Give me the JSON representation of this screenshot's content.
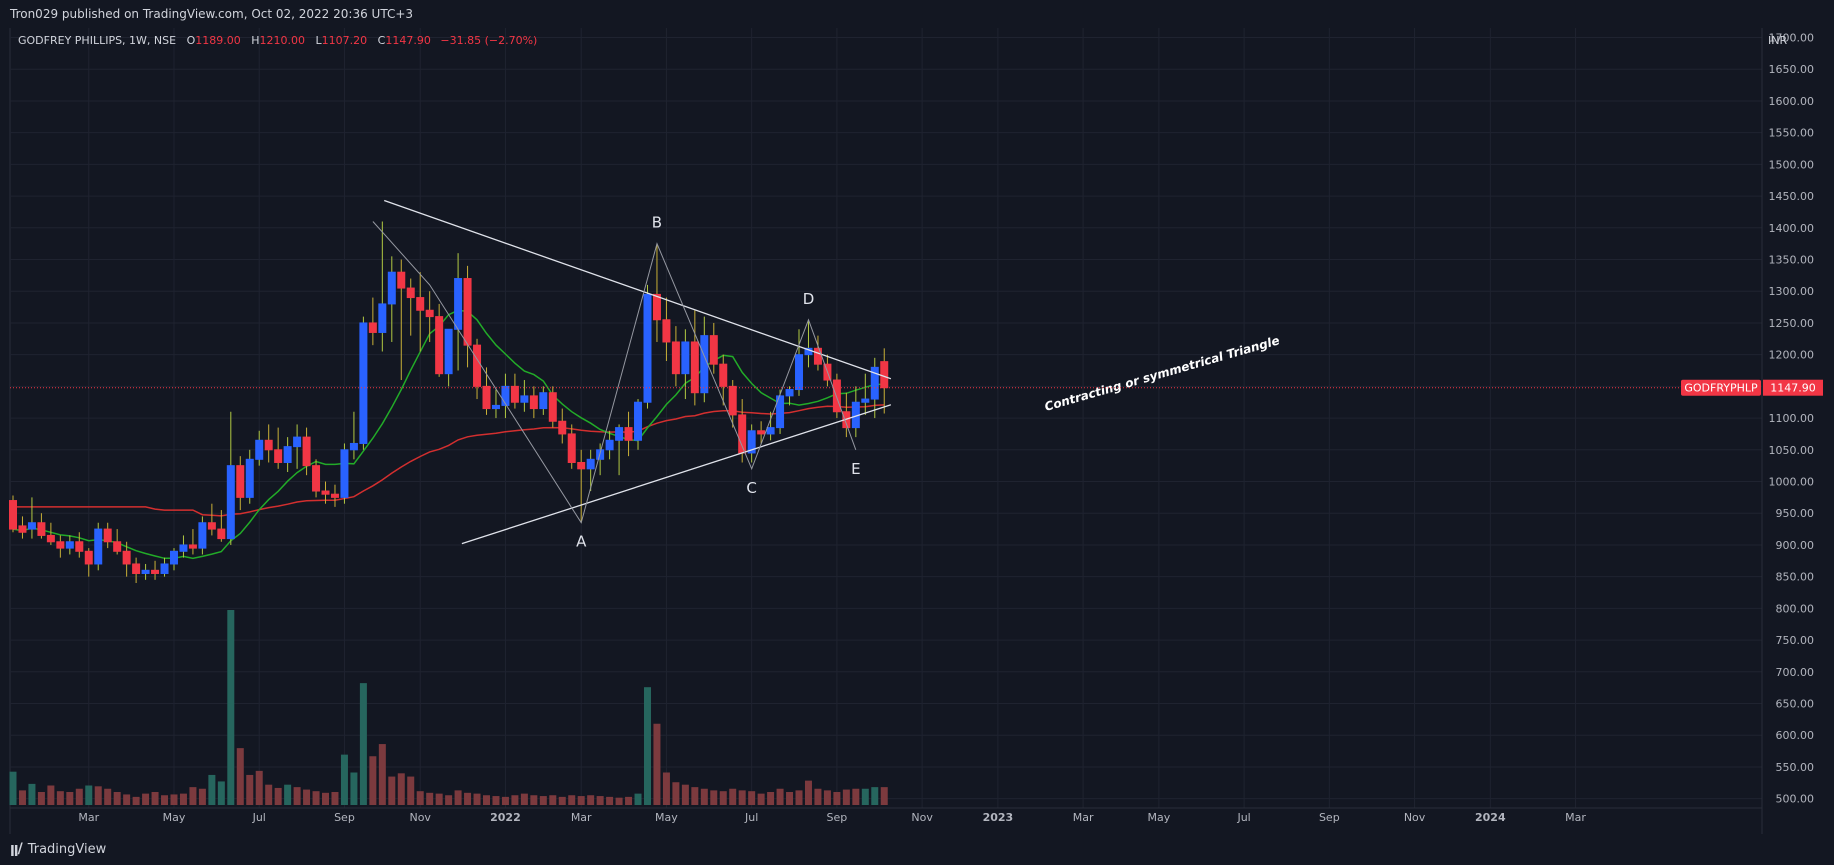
{
  "header": {
    "published_by": "Tron029 published on TradingView.com, Oct 02, 2022 20:36 UTC+3"
  },
  "legend": {
    "symbol_line": "GODFREY PHILLIPS, 1W, NSE",
    "open_label": "O",
    "open_value": "1189.00",
    "high_label": "H",
    "high_value": "1210.00",
    "low_label": "L",
    "low_value": "1107.20",
    "close_label": "C",
    "close_value": "1147.90",
    "change": "−31.85 (−2.70%)"
  },
  "price_axis": {
    "currency": "INR",
    "tag_symbol": "GODFRYPHLP",
    "tag_price": "1147.90"
  },
  "footer": {
    "brand_icon": "tradingview-logo-icon",
    "brand_name": "TradingView"
  },
  "colors": {
    "background": "#131722",
    "grid": "#1f2330",
    "up": "#2962ff",
    "down": "#f23645",
    "wick_up": "#b2c943",
    "ema_fast": "#22ab28",
    "ema_slow": "#d32f2f",
    "vol_up": "#26665e",
    "vol_down": "#7c3a3e",
    "trendline": "#e0e3eb"
  },
  "chart_data": {
    "type": "candlestick",
    "title": "GODFREY PHILLIPS, 1W, NSE",
    "ylabel": "INR",
    "ylim": [
      490,
      1715
    ],
    "y_ticks": [
      "500.00",
      "550.00",
      "600.00",
      "650.00",
      "700.00",
      "750.00",
      "800.00",
      "850.00",
      "900.00",
      "950.00",
      "1000.00",
      "1050.00",
      "1100.00",
      "1150.00",
      "1200.00",
      "1250.00",
      "1300.00",
      "1350.00",
      "1400.00",
      "1450.00",
      "1500.00",
      "1550.00",
      "1600.00",
      "1650.00",
      "1700.00"
    ],
    "x_ticks": [
      {
        "label": "Mar",
        "week": 8
      },
      {
        "label": "May",
        "week": 17
      },
      {
        "label": "Jul",
        "week": 26
      },
      {
        "label": "Sep",
        "week": 35
      },
      {
        "label": "Nov",
        "week": 43
      },
      {
        "label": "2022",
        "week": 52
      },
      {
        "label": "Mar",
        "week": 60
      },
      {
        "label": "May",
        "week": 69
      },
      {
        "label": "Jul",
        "week": 78
      },
      {
        "label": "Sep",
        "week": 87
      },
      {
        "label": "Nov",
        "week": 96
      },
      {
        "label": "2023",
        "week": 104
      },
      {
        "label": "Mar",
        "week": 113
      },
      {
        "label": "May",
        "week": 121
      },
      {
        "label": "Jul",
        "week": 130
      },
      {
        "label": "Sep",
        "week": 139
      },
      {
        "label": "Nov",
        "week": 148
      },
      {
        "label": "2024",
        "week": 156
      },
      {
        "label": "Mar",
        "week": 165
      }
    ],
    "candles": [
      [
        970,
        978,
        920,
        925
      ],
      [
        930,
        945,
        910,
        920
      ],
      [
        925,
        975,
        910,
        935
      ],
      [
        935,
        950,
        910,
        915
      ],
      [
        915,
        935,
        900,
        905
      ],
      [
        905,
        915,
        880,
        895
      ],
      [
        895,
        915,
        885,
        905
      ],
      [
        905,
        920,
        880,
        890
      ],
      [
        890,
        895,
        850,
        870
      ],
      [
        870,
        935,
        860,
        925
      ],
      [
        925,
        935,
        895,
        905
      ],
      [
        905,
        925,
        885,
        890
      ],
      [
        890,
        905,
        850,
        870
      ],
      [
        870,
        880,
        840,
        855
      ],
      [
        855,
        870,
        845,
        860
      ],
      [
        860,
        875,
        845,
        855
      ],
      [
        855,
        880,
        850,
        870
      ],
      [
        870,
        895,
        860,
        890
      ],
      [
        890,
        915,
        880,
        900
      ],
      [
        900,
        925,
        885,
        895
      ],
      [
        895,
        945,
        885,
        935
      ],
      [
        935,
        965,
        915,
        925
      ],
      [
        925,
        955,
        905,
        910
      ],
      [
        910,
        1110,
        900,
        1025
      ],
      [
        1025,
        1040,
        955,
        975
      ],
      [
        975,
        1050,
        965,
        1035
      ],
      [
        1035,
        1080,
        1025,
        1065
      ],
      [
        1065,
        1090,
        1030,
        1050
      ],
      [
        1050,
        1085,
        1020,
        1030
      ],
      [
        1030,
        1070,
        1015,
        1055
      ],
      [
        1055,
        1090,
        1020,
        1070
      ],
      [
        1070,
        1085,
        1010,
        1025
      ],
      [
        1025,
        1035,
        975,
        985
      ],
      [
        985,
        1000,
        965,
        980
      ],
      [
        980,
        995,
        960,
        975
      ],
      [
        975,
        1060,
        965,
        1050
      ],
      [
        1050,
        1110,
        1035,
        1060
      ],
      [
        1060,
        1260,
        1050,
        1250
      ],
      [
        1250,
        1290,
        1215,
        1235
      ],
      [
        1235,
        1410,
        1205,
        1280
      ],
      [
        1280,
        1355,
        1220,
        1330
      ],
      [
        1330,
        1350,
        1160,
        1305
      ],
      [
        1305,
        1320,
        1230,
        1290
      ],
      [
        1290,
        1330,
        1205,
        1270
      ],
      [
        1270,
        1300,
        1220,
        1260
      ],
      [
        1260,
        1280,
        1165,
        1170
      ],
      [
        1170,
        1240,
        1150,
        1240
      ],
      [
        1240,
        1360,
        1175,
        1320
      ],
      [
        1320,
        1340,
        1180,
        1215
      ],
      [
        1215,
        1225,
        1130,
        1150
      ],
      [
        1150,
        1180,
        1105,
        1115
      ],
      [
        1115,
        1145,
        1100,
        1120
      ],
      [
        1120,
        1170,
        1100,
        1150
      ],
      [
        1150,
        1170,
        1115,
        1125
      ],
      [
        1125,
        1160,
        1110,
        1135
      ],
      [
        1135,
        1150,
        1100,
        1115
      ],
      [
        1115,
        1150,
        1105,
        1140
      ],
      [
        1140,
        1150,
        1085,
        1095
      ],
      [
        1095,
        1115,
        1060,
        1075
      ],
      [
        1075,
        1090,
        1020,
        1030
      ],
      [
        1030,
        1050,
        935,
        1020
      ],
      [
        1020,
        1050,
        985,
        1035
      ],
      [
        1035,
        1060,
        1010,
        1050
      ],
      [
        1050,
        1080,
        1035,
        1065
      ],
      [
        1065,
        1090,
        1010,
        1085
      ],
      [
        1085,
        1110,
        1040,
        1065
      ],
      [
        1065,
        1130,
        1050,
        1125
      ],
      [
        1125,
        1310,
        1115,
        1295
      ],
      [
        1295,
        1375,
        1220,
        1255
      ],
      [
        1255,
        1290,
        1190,
        1220
      ],
      [
        1220,
        1245,
        1150,
        1170
      ],
      [
        1170,
        1240,
        1130,
        1220
      ],
      [
        1220,
        1270,
        1120,
        1140
      ],
      [
        1140,
        1260,
        1125,
        1230
      ],
      [
        1230,
        1250,
        1170,
        1185
      ],
      [
        1185,
        1200,
        1120,
        1150
      ],
      [
        1150,
        1160,
        1085,
        1105
      ],
      [
        1105,
        1130,
        1030,
        1045
      ],
      [
        1045,
        1090,
        1030,
        1080
      ],
      [
        1080,
        1095,
        1060,
        1075
      ],
      [
        1075,
        1110,
        1065,
        1085
      ],
      [
        1085,
        1145,
        1075,
        1135
      ],
      [
        1135,
        1150,
        1120,
        1145
      ],
      [
        1145,
        1240,
        1135,
        1200
      ],
      [
        1200,
        1255,
        1180,
        1210
      ],
      [
        1210,
        1230,
        1175,
        1185
      ],
      [
        1185,
        1200,
        1150,
        1160
      ],
      [
        1160,
        1170,
        1100,
        1110
      ],
      [
        1110,
        1140,
        1070,
        1085
      ],
      [
        1085,
        1150,
        1070,
        1125
      ],
      [
        1125,
        1170,
        1105,
        1130
      ],
      [
        1130,
        1195,
        1100,
        1180
      ],
      [
        1189,
        1210,
        1107.2,
        1147.9
      ]
    ],
    "volume": [
      [
        41,
        1
      ],
      [
        18,
        0
      ],
      [
        26,
        1
      ],
      [
        16,
        0
      ],
      [
        24,
        0
      ],
      [
        17,
        0
      ],
      [
        16,
        0
      ],
      [
        20,
        0
      ],
      [
        24,
        1
      ],
      [
        23,
        0
      ],
      [
        20,
        0
      ],
      [
        16,
        0
      ],
      [
        13,
        0
      ],
      [
        10,
        0
      ],
      [
        14,
        0
      ],
      [
        16,
        0
      ],
      [
        12,
        0
      ],
      [
        13,
        0
      ],
      [
        14,
        0
      ],
      [
        22,
        0
      ],
      [
        20,
        0
      ],
      [
        37,
        1
      ],
      [
        29,
        1
      ],
      [
        240,
        1
      ],
      [
        70,
        0
      ],
      [
        37,
        0
      ],
      [
        42,
        0
      ],
      [
        25,
        0
      ],
      [
        21,
        0
      ],
      [
        25,
        1
      ],
      [
        22,
        0
      ],
      [
        19,
        0
      ],
      [
        17,
        0
      ],
      [
        15,
        0
      ],
      [
        16,
        0
      ],
      [
        62,
        1
      ],
      [
        40,
        1
      ],
      [
        150,
        1
      ],
      [
        60,
        0
      ],
      [
        75,
        0
      ],
      [
        35,
        0
      ],
      [
        39,
        0
      ],
      [
        35,
        0
      ],
      [
        17,
        0
      ],
      [
        15,
        0
      ],
      [
        14,
        0
      ],
      [
        12,
        0
      ],
      [
        18,
        0
      ],
      [
        15,
        0
      ],
      [
        14,
        0
      ],
      [
        12,
        0
      ],
      [
        11,
        0
      ],
      [
        10,
        0
      ],
      [
        12,
        0
      ],
      [
        14,
        0
      ],
      [
        12,
        0
      ],
      [
        11,
        0
      ],
      [
        12,
        0
      ],
      [
        10,
        0
      ],
      [
        12,
        0
      ],
      [
        11,
        0
      ],
      [
        12,
        0
      ],
      [
        11,
        0
      ],
      [
        10,
        0
      ],
      [
        9,
        0
      ],
      [
        10,
        0
      ],
      [
        14,
        1
      ],
      [
        145,
        1
      ],
      [
        100,
        0
      ],
      [
        40,
        0
      ],
      [
        28,
        0
      ],
      [
        25,
        0
      ],
      [
        22,
        0
      ],
      [
        20,
        0
      ],
      [
        18,
        0
      ],
      [
        17,
        0
      ],
      [
        20,
        0
      ],
      [
        18,
        0
      ],
      [
        17,
        0
      ],
      [
        14,
        0
      ],
      [
        16,
        0
      ],
      [
        20,
        0
      ],
      [
        16,
        0
      ],
      [
        18,
        0
      ],
      [
        30,
        0
      ],
      [
        20,
        0
      ],
      [
        18,
        0
      ],
      [
        16,
        0
      ],
      [
        19,
        0
      ],
      [
        20,
        0
      ],
      [
        20,
        1
      ],
      [
        22,
        1
      ],
      [
        22,
        0
      ]
    ],
    "ema_fast_label": "",
    "ema_slow_label": ""
  },
  "annotations": {
    "point_labels": [
      {
        "text": "A",
        "week": 60,
        "price": 935
      },
      {
        "text": "B",
        "week": 68,
        "price": 1375
      },
      {
        "text": "C",
        "week": 78,
        "price": 1020
      },
      {
        "text": "D",
        "week": 84,
        "price": 1255
      },
      {
        "text": "E",
        "week": 89,
        "price": 1050
      }
    ],
    "pattern_text": "Contracting or symmetrical Triangle"
  }
}
